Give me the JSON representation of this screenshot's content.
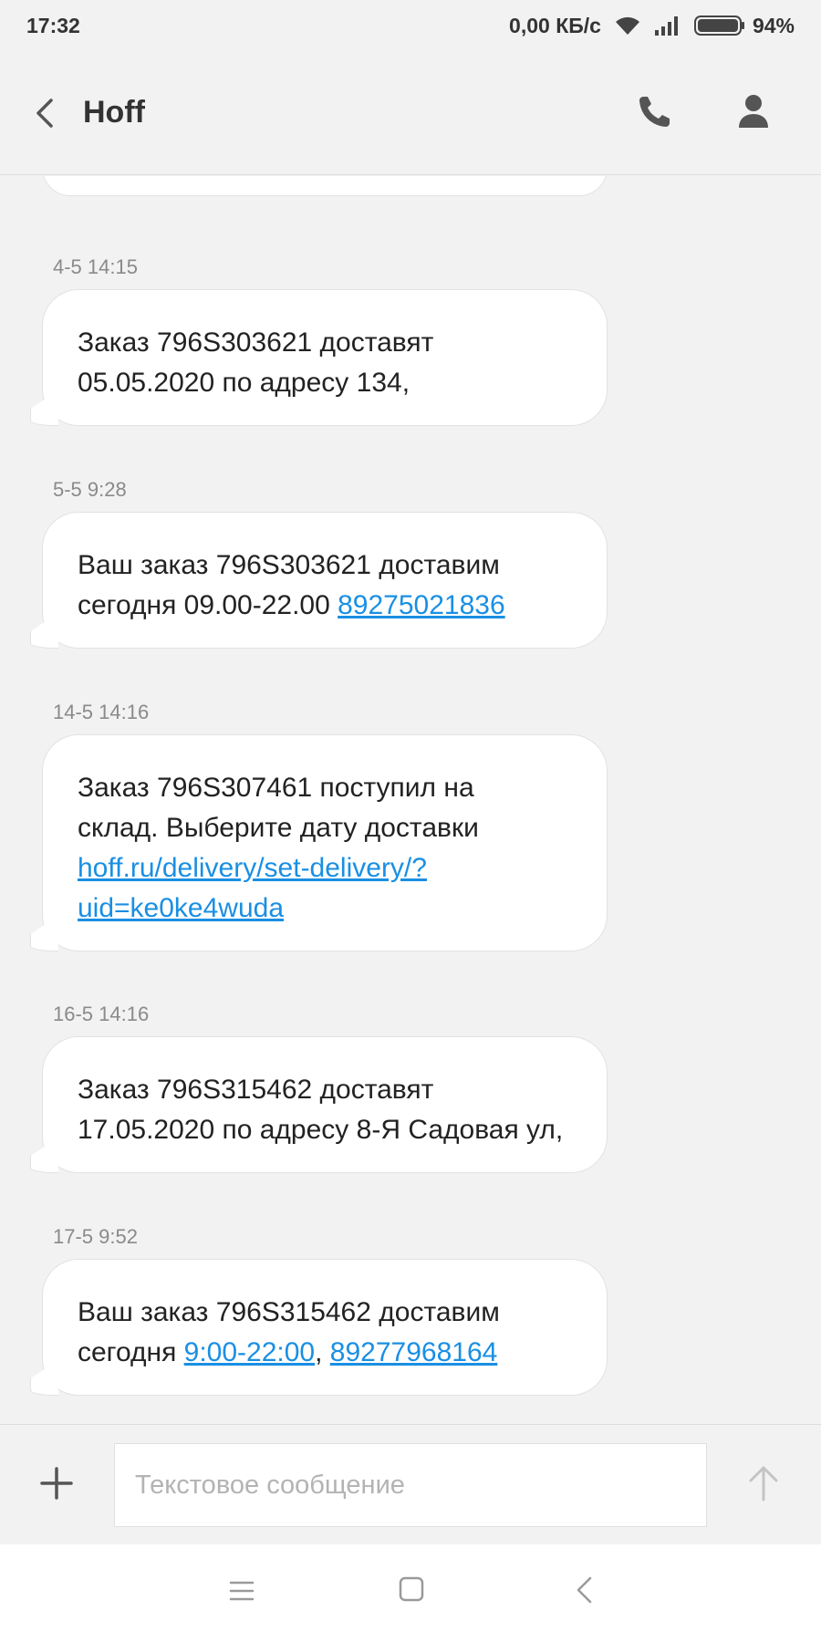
{
  "status_bar": {
    "time": "17:32",
    "network_speed": "0,00 КБ/с",
    "battery_percent": "94%",
    "icons": [
      "wifi-icon",
      "signal-icon",
      "battery-icon"
    ]
  },
  "header": {
    "title": "Hoff",
    "icons": [
      "back-arrow-icon",
      "phone-icon",
      "contact-icon"
    ]
  },
  "messages": [
    {
      "time": "4-5 14:15",
      "lines": [
        [
          {
            "text": "Заказ 796S303621 доставят"
          }
        ],
        [
          {
            "text": "05.05.2020 по адресу 134,"
          }
        ]
      ]
    },
    {
      "time": "5-5 9:28",
      "lines": [
        [
          {
            "text": "Ваш заказ 796S303621 доставим"
          }
        ],
        [
          {
            "text": "сегодня 09.00-22.00 "
          },
          {
            "text": "89275021836",
            "link": true
          }
        ]
      ]
    },
    {
      "time": "14-5 14:16",
      "lines": [
        [
          {
            "text": "Заказ 796S307461 поступил на"
          }
        ],
        [
          {
            "text": "склад. Выберите дату доставки"
          }
        ],
        [
          {
            "text": "hoff.ru/delivery/set-delivery/?",
            "link": true
          }
        ],
        [
          {
            "text": "uid=ke0ke4wuda",
            "link": true
          }
        ]
      ]
    },
    {
      "time": "16-5 14:16",
      "lines": [
        [
          {
            "text": "Заказ 796S315462 доставят"
          }
        ],
        [
          {
            "text": "17.05.2020 по адресу 8-Я Садовая ул,"
          }
        ]
      ]
    },
    {
      "time": "17-5 9:52",
      "lines": [
        [
          {
            "text": "Ваш заказ 796S315462 доставим"
          }
        ],
        [
          {
            "text": "сегодня "
          },
          {
            "text": "9:00-22:00",
            "link": true
          },
          {
            "text": ", "
          },
          {
            "text": "89277968164",
            "link": true
          }
        ]
      ]
    }
  ],
  "composer": {
    "placeholder": "Текстовое сообщение",
    "value": ""
  },
  "colors": {
    "background": "#f2f2f2",
    "bubble": "#ffffff",
    "link": "#1a8fe3",
    "timestamp": "#8a8a8a"
  }
}
